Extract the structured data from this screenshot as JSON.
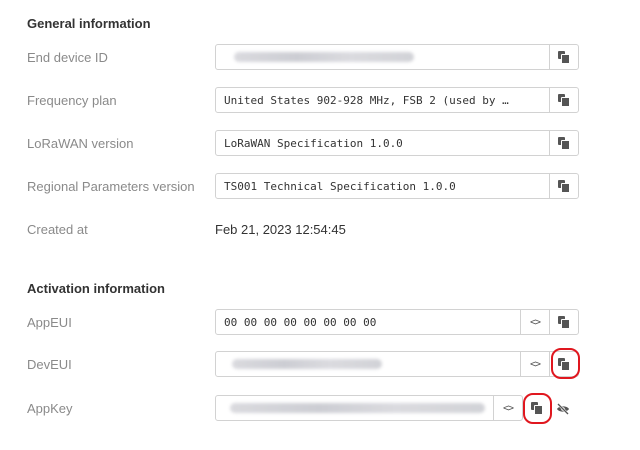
{
  "general": {
    "title": "General information",
    "rows": {
      "end_device_id": {
        "label": "End device ID",
        "value": ""
      },
      "frequency_plan": {
        "label": "Frequency plan",
        "value": "United States 902-928 MHz, FSB 2 (used by …"
      },
      "lorawan_version": {
        "label": "LoRaWAN version",
        "value": "LoRaWAN Specification 1.0.0"
      },
      "regional_params": {
        "label": "Regional Parameters version",
        "value": "TS001 Technical Specification 1.0.0"
      },
      "created_at": {
        "label": "Created at",
        "value": "Feb 21, 2023 12:54:45"
      }
    }
  },
  "activation": {
    "title": "Activation information",
    "rows": {
      "appeui": {
        "label": "AppEUI",
        "value": "00 00 00 00 00 00 00 00"
      },
      "deveui": {
        "label": "DevEUI",
        "value": ""
      },
      "appkey": {
        "label": "AppKey",
        "value": ""
      }
    }
  },
  "icons": {
    "copy": "copy-icon",
    "code": "code-toggle-icon",
    "eye_off": "eye-slash-icon"
  },
  "colors": {
    "highlight": "#e0171f"
  }
}
